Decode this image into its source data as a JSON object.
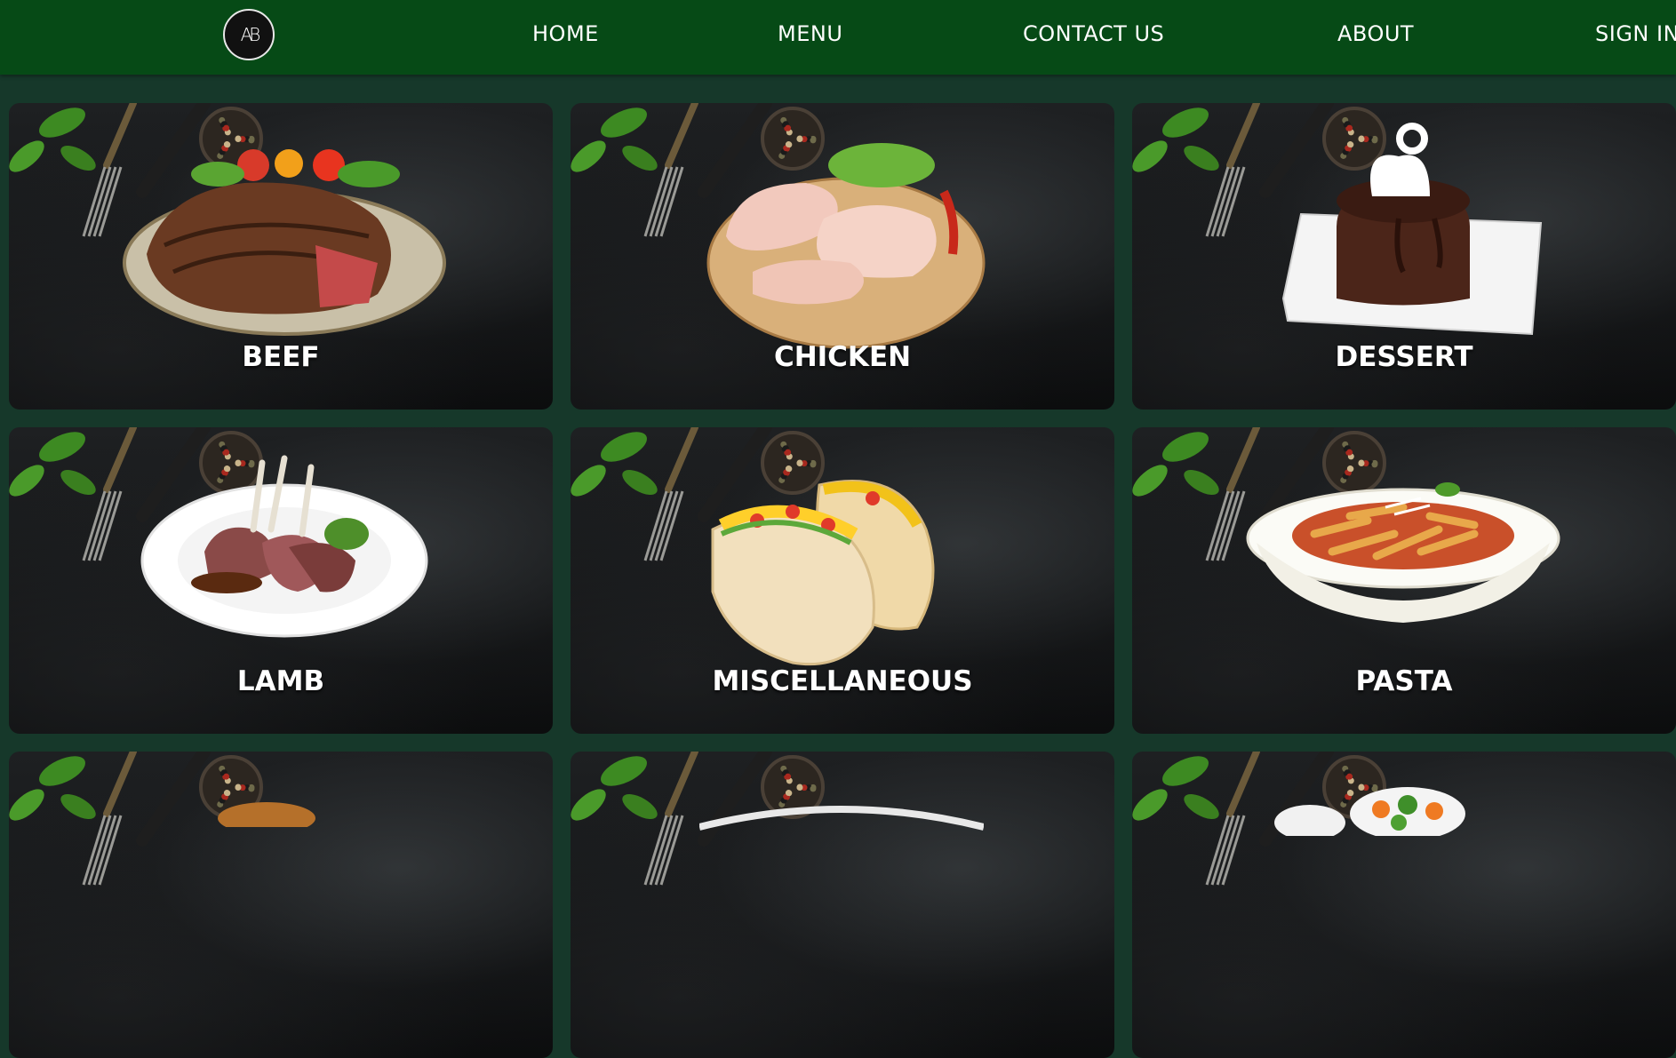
{
  "navbar": {
    "logo_text": "AB",
    "links": [
      "HOME",
      "MENU",
      "CONTACT US",
      "ABOUT",
      "SIGN IN"
    ]
  },
  "categories": [
    {
      "label": "BEEF",
      "image": "steak-plate-icon"
    },
    {
      "label": "CHICKEN",
      "image": "chicken-legs-icon"
    },
    {
      "label": "DESSERT",
      "image": "chocolate-cake-icon"
    },
    {
      "label": "LAMB",
      "image": "lamb-chops-icon"
    },
    {
      "label": "MISCELLANEOUS",
      "image": "tacos-icon"
    },
    {
      "label": "PASTA",
      "image": "pasta-bowl-icon"
    },
    {
      "label": "",
      "image": "partial-dish-icon"
    },
    {
      "label": "",
      "image": "partial-dish-icon"
    },
    {
      "label": "",
      "image": "vegetables-bowl-icon"
    }
  ],
  "colors": {
    "navbar": "#064a16",
    "background": "#16382a",
    "card": "#111314"
  }
}
